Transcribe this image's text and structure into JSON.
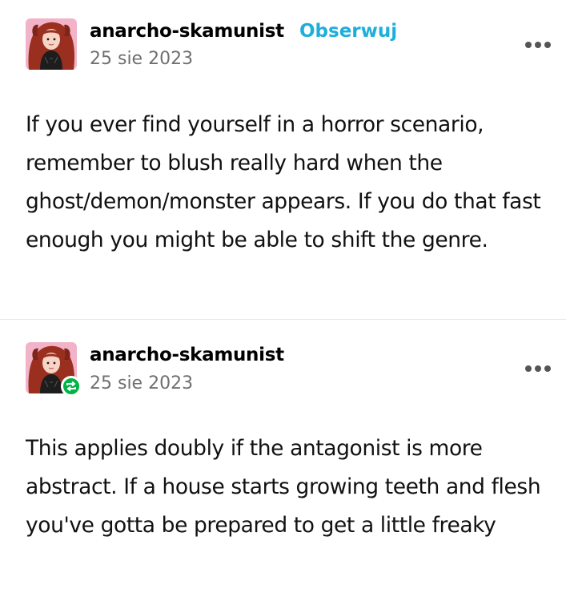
{
  "posts": [
    {
      "username": "anarcho-skamunist",
      "follow_label": "Obserwuj",
      "date": "25 sie 2023",
      "body": "If you ever find yourself in a horror scenario, remember to blush really hard when the ghost/demon/monster appears. If you do that fast enough you might be able to shift the genre.",
      "avatar_icon": "avatar-image",
      "more_icon": "more-options-icon"
    },
    {
      "username": "anarcho-skamunist",
      "date": "25 sie 2023",
      "body": "This applies doubly if the antagonist is more abstract. If a house starts growing teeth and flesh you've gotta be prepared to get a little freaky",
      "avatar_icon": "avatar-image",
      "badge_icon": "reblog-icon",
      "more_icon": "more-options-icon"
    }
  ],
  "colors": {
    "follow": "#1eaedb",
    "date": "#707070",
    "reblog_badge": "#00b545",
    "avatar_bg": "#f2b3c8",
    "hair": "#9a2f1f"
  }
}
